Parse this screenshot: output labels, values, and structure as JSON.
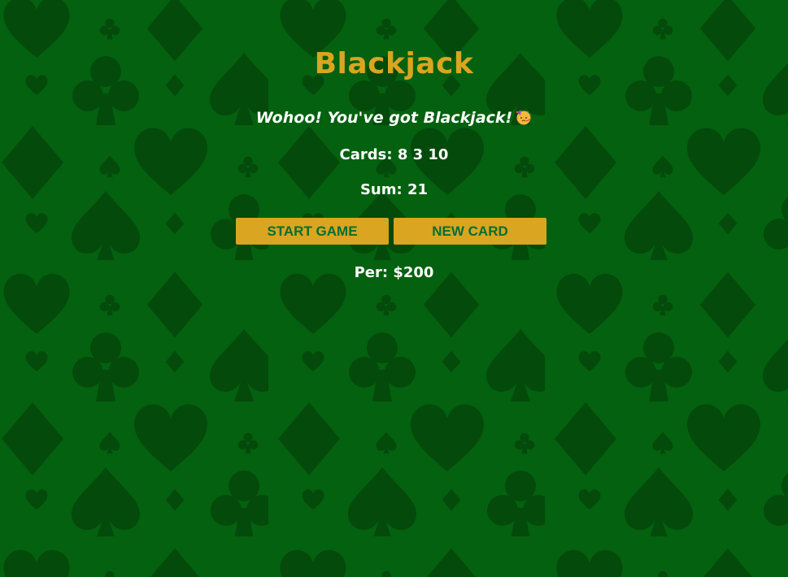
{
  "app": {
    "title": "Blackjack"
  },
  "game": {
    "message": "Wohoo! You've got Blackjack!",
    "message_emoji": "partying-face-icon",
    "cards_label": "Cards: 8 3 10",
    "sum_label": "Sum: 21",
    "player_label": "Per: $200"
  },
  "buttons": {
    "start_label": "START GAME",
    "new_card_label": "NEW CARD"
  },
  "colors": {
    "background": "#04610f",
    "suit_pattern": "#034a0b",
    "title": "#daa520",
    "button_bg": "#daa520",
    "button_text": "#016f32",
    "text": "#ffffff"
  },
  "background_pattern": {
    "suits": [
      "heart-icon",
      "club-icon",
      "diamond-icon",
      "spade-icon"
    ]
  }
}
